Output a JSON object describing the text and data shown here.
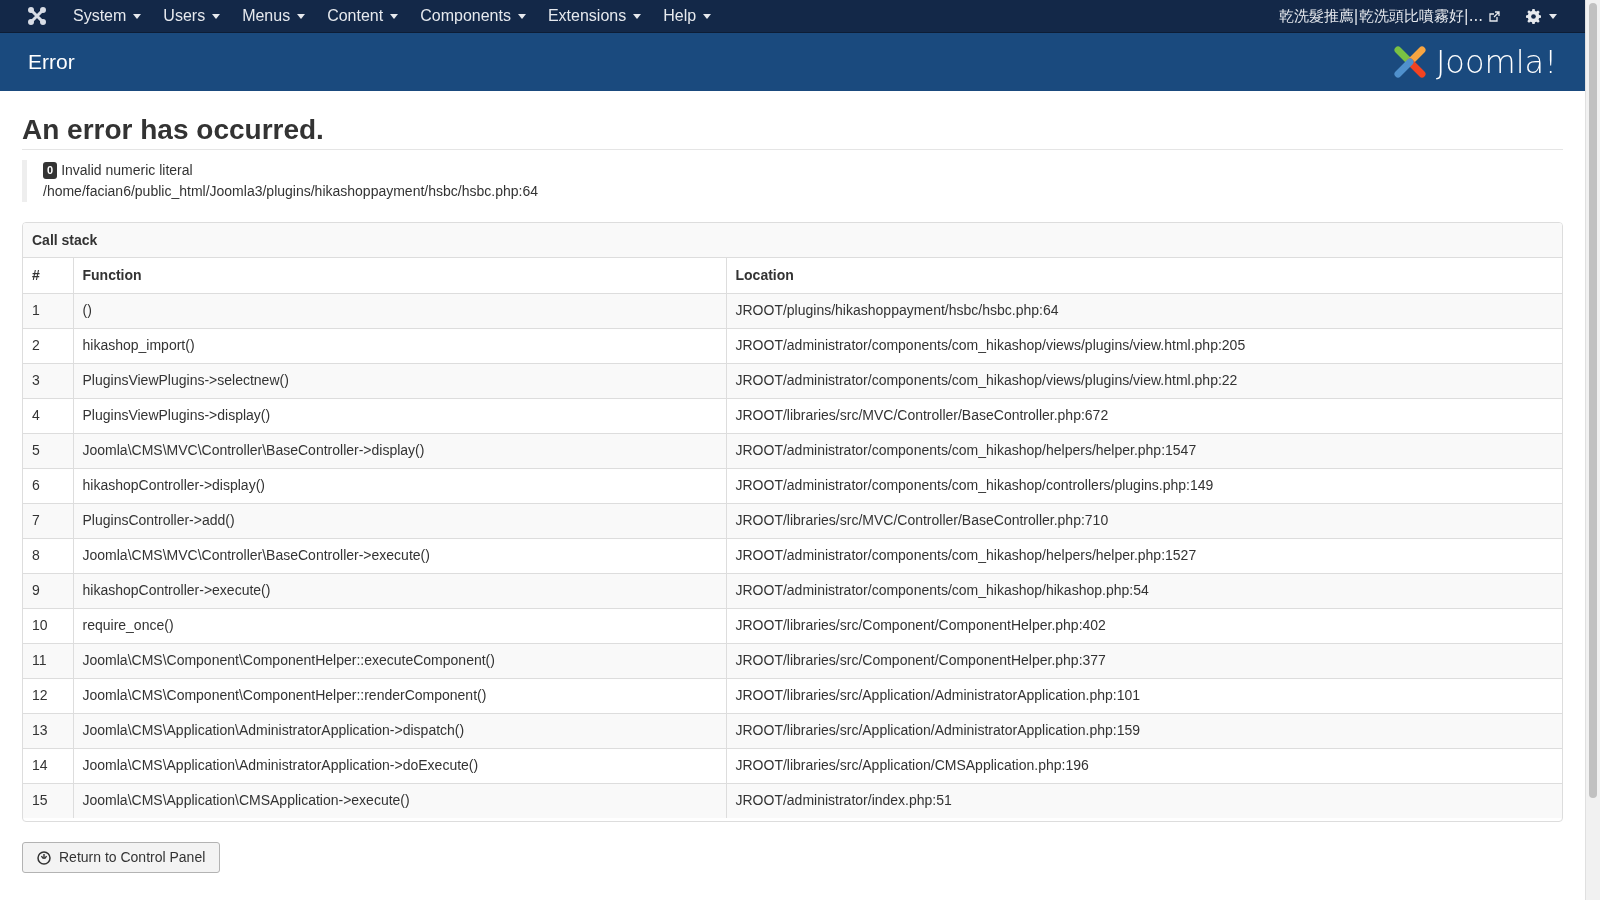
{
  "navbar": {
    "menus": [
      "System",
      "Users",
      "Menus",
      "Content",
      "Components",
      "Extensions",
      "Help"
    ],
    "site_link": "乾洗髮推薦|乾洗頭比噴霧好|..."
  },
  "header": {
    "title": "Error",
    "logo_text": "Joomla!"
  },
  "error": {
    "heading": "An error has occurred.",
    "code": "0",
    "message": "Invalid numeric literal",
    "file": "/home/facian6/public_html/Joomla3/plugins/hikashoppayment/hsbc/hsbc.php:64"
  },
  "call_stack": {
    "title": "Call stack",
    "columns": [
      "#",
      "Function",
      "Location"
    ],
    "rows": [
      [
        "1",
        "()",
        "JROOT/plugins/hikashoppayment/hsbc/hsbc.php:64"
      ],
      [
        "2",
        "hikashop_import()",
        "JROOT/administrator/components/com_hikashop/views/plugins/view.html.php:205"
      ],
      [
        "3",
        "PluginsViewPlugins->selectnew()",
        "JROOT/administrator/components/com_hikashop/views/plugins/view.html.php:22"
      ],
      [
        "4",
        "PluginsViewPlugins->display()",
        "JROOT/libraries/src/MVC/Controller/BaseController.php:672"
      ],
      [
        "5",
        "Joomla\\CMS\\MVC\\Controller\\BaseController->display()",
        "JROOT/administrator/components/com_hikashop/helpers/helper.php:1547"
      ],
      [
        "6",
        "hikashopController->display()",
        "JROOT/administrator/components/com_hikashop/controllers/plugins.php:149"
      ],
      [
        "7",
        "PluginsController->add()",
        "JROOT/libraries/src/MVC/Controller/BaseController.php:710"
      ],
      [
        "8",
        "Joomla\\CMS\\MVC\\Controller\\BaseController->execute()",
        "JROOT/administrator/components/com_hikashop/helpers/helper.php:1527"
      ],
      [
        "9",
        "hikashopController->execute()",
        "JROOT/administrator/components/com_hikashop/hikashop.php:54"
      ],
      [
        "10",
        "require_once()",
        "JROOT/libraries/src/Component/ComponentHelper.php:402"
      ],
      [
        "11",
        "Joomla\\CMS\\Component\\ComponentHelper::executeComponent()",
        "JROOT/libraries/src/Component/ComponentHelper.php:377"
      ],
      [
        "12",
        "Joomla\\CMS\\Component\\ComponentHelper::renderComponent()",
        "JROOT/libraries/src/Application/AdministratorApplication.php:101"
      ],
      [
        "13",
        "Joomla\\CMS\\Application\\AdministratorApplication->dispatch()",
        "JROOT/libraries/src/Application/AdministratorApplication.php:159"
      ],
      [
        "14",
        "Joomla\\CMS\\Application\\AdministratorApplication->doExecute()",
        "JROOT/libraries/src/Application/CMSApplication.php:196"
      ],
      [
        "15",
        "Joomla\\CMS\\Application\\CMSApplication->execute()",
        "JROOT/administrator/index.php:51"
      ]
    ]
  },
  "return_button": "Return to Control Panel"
}
